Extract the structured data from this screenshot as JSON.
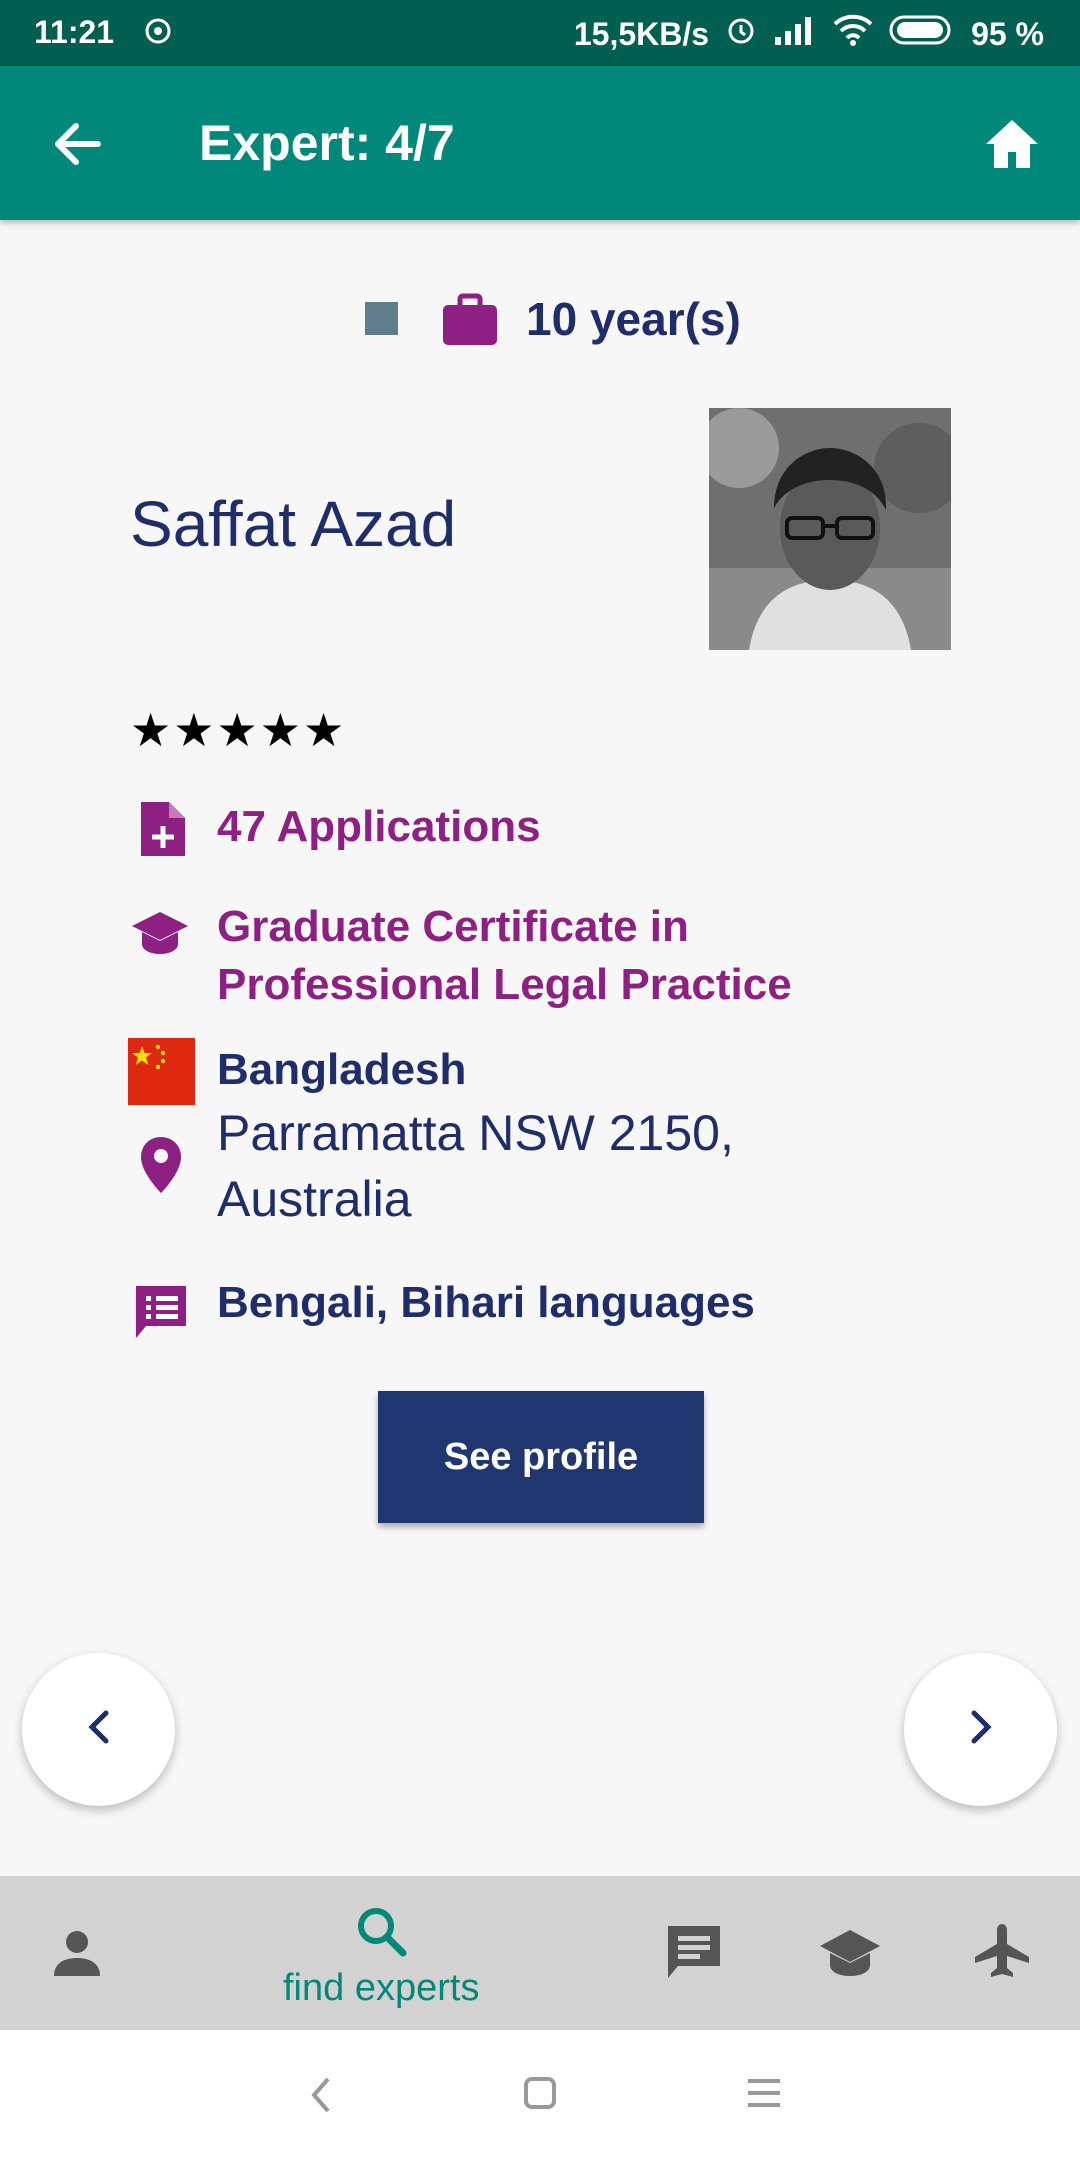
{
  "status_bar": {
    "time": "11:21",
    "network_speed": "15,5KB/s",
    "battery": "95 %"
  },
  "app_bar": {
    "title": "Expert: 4/7",
    "back_icon": "arrow-back-icon",
    "home_icon": "home-icon"
  },
  "expert": {
    "experience": "10 year(s)",
    "name": "Saffat Azad",
    "rating_stars": "★★★★★",
    "rating": 5,
    "applications": "47 Applications",
    "qualification": "Graduate Certificate in Professional Legal Practice",
    "country": "Bangladesh",
    "address": "Parramatta NSW 2150, Australia",
    "languages": "Bengali, Bihari languages"
  },
  "actions": {
    "see_profile": "See profile"
  },
  "bottom_nav": {
    "items": [
      {
        "icon": "person-icon",
        "label": ""
      },
      {
        "icon": "search-icon",
        "label": "find experts",
        "active": true
      },
      {
        "icon": "chat-icon",
        "label": ""
      },
      {
        "icon": "graduation-cap-icon",
        "label": ""
      },
      {
        "icon": "airplane-icon",
        "label": ""
      }
    ]
  },
  "colors": {
    "primary": "#00897b",
    "status_bar": "#005f50",
    "navy": "#1f2d6b",
    "purple": "#8e1f83",
    "button": "#1f3671"
  }
}
